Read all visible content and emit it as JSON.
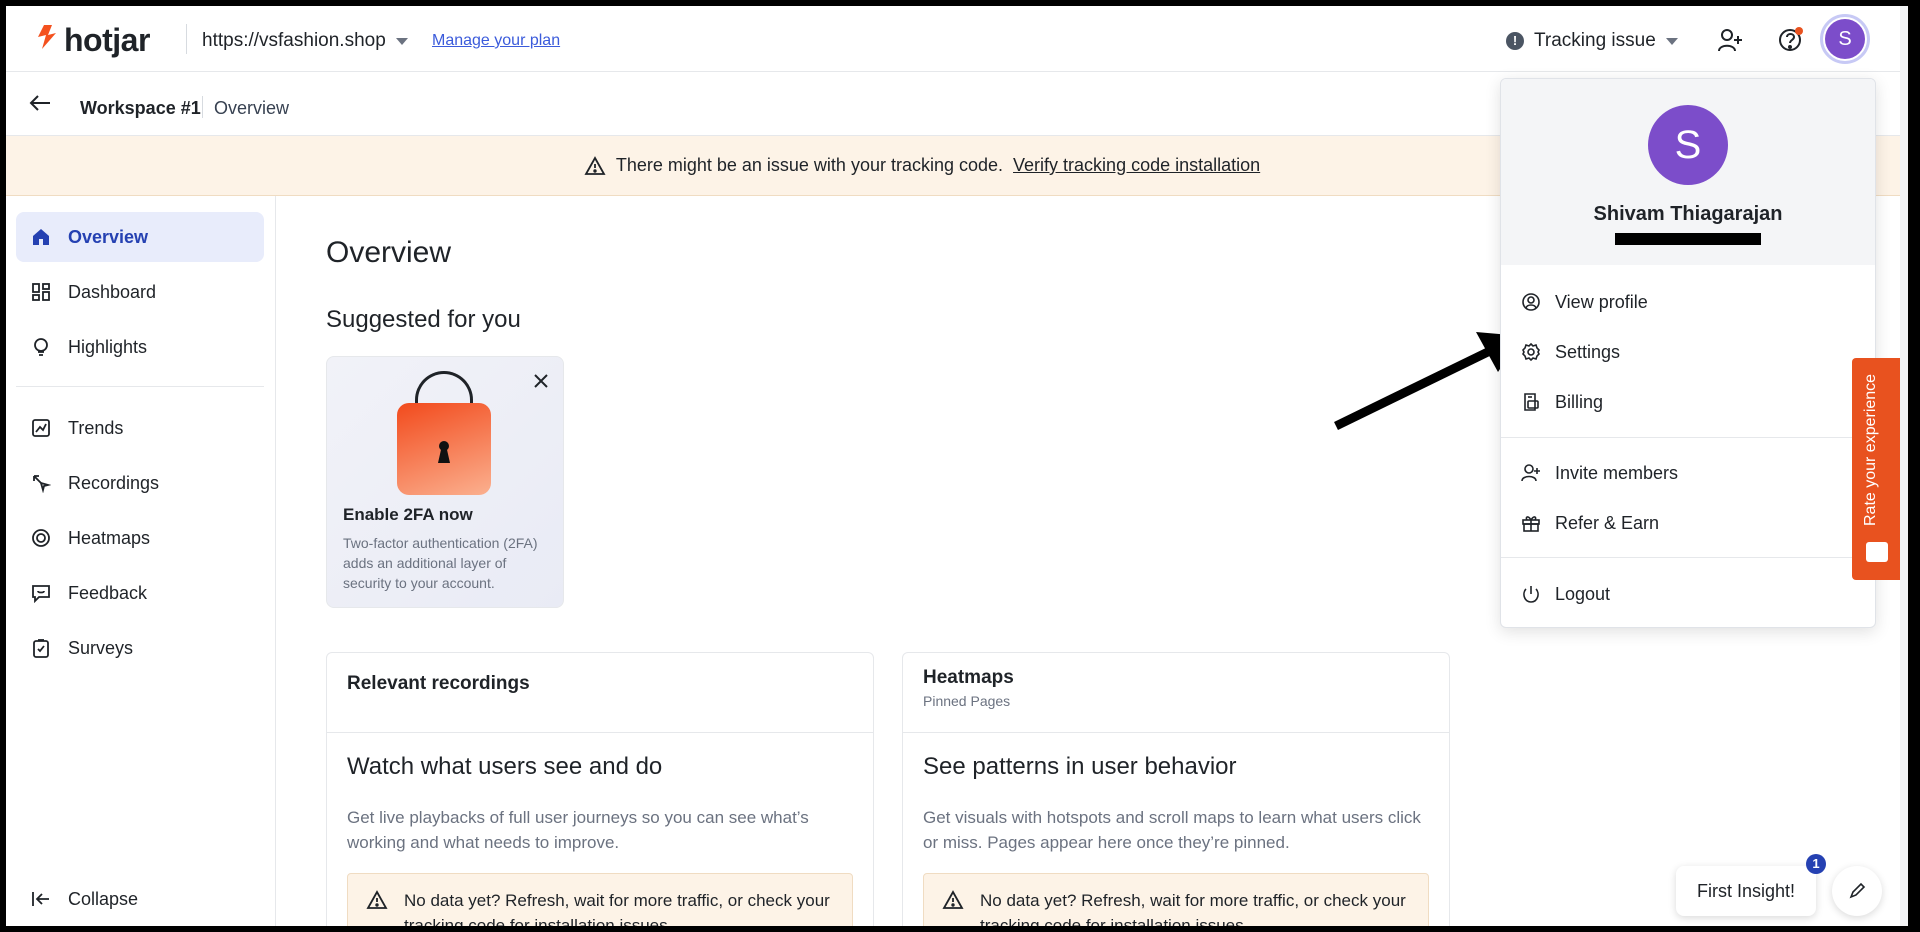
{
  "header": {
    "logo_text": "hotjar",
    "site_url": "https://vsfashion.shop",
    "manage_plan": "Manage your plan",
    "tracking_status": "Tracking issue",
    "avatar_initial": "S"
  },
  "breadcrumb": {
    "workspace": "Workspace #1",
    "page": "Overview"
  },
  "banner": {
    "message": "There might be an issue with your tracking code.",
    "link": "Verify tracking code installation"
  },
  "sidebar": {
    "items": [
      {
        "label": "Overview",
        "icon": "home-icon",
        "active": true
      },
      {
        "label": "Dashboard",
        "icon": "dashboard-icon"
      },
      {
        "label": "Highlights",
        "icon": "lightbulb-icon"
      },
      {
        "label": "Trends",
        "icon": "trends-icon"
      },
      {
        "label": "Recordings",
        "icon": "recordings-icon"
      },
      {
        "label": "Heatmaps",
        "icon": "heatmaps-icon"
      },
      {
        "label": "Feedback",
        "icon": "feedback-icon"
      },
      {
        "label": "Surveys",
        "icon": "surveys-icon"
      }
    ],
    "collapse": "Collapse"
  },
  "main": {
    "title": "Overview",
    "suggested_heading": "Suggested for you",
    "card_2fa": {
      "title": "Enable 2FA now",
      "description": "Two-factor authentication (2FA) adds an additional layer of security to your account."
    },
    "panels": [
      {
        "title": "Relevant recordings",
        "subtitle": "",
        "headline": "Watch what users see and do",
        "text": "Get live playbacks of full user journeys so you can see what’s working and what needs to improve.",
        "alert": "No data yet? Refresh, wait for more traffic, or check your tracking code for installation issues."
      },
      {
        "title": "Heatmaps",
        "subtitle": "Pinned Pages",
        "headline": "See patterns in user behavior",
        "text": "Get visuals with hotspots and scroll maps to learn what users click or miss. Pages appear here once they’re pinned.",
        "alert": "No data yet? Refresh, wait for more traffic, or check your tracking code for installation issues."
      }
    ]
  },
  "profile_menu": {
    "initial": "S",
    "name": "Shivam Thiagarajan",
    "items": [
      {
        "label": "View profile",
        "icon": "user-circle-icon"
      },
      {
        "label": "Settings",
        "icon": "gear-icon"
      },
      {
        "label": "Billing",
        "icon": "billing-icon"
      },
      {
        "label": "Invite members",
        "icon": "invite-user-icon"
      },
      {
        "label": "Refer & Earn",
        "icon": "gift-icon"
      },
      {
        "label": "Logout",
        "icon": "power-icon"
      }
    ]
  },
  "widgets": {
    "rate_experience": "Rate your experience",
    "first_insight": "First Insight!",
    "first_insight_badge": "1"
  },
  "colors": {
    "brand": "#f4511e",
    "accent": "#2541b2",
    "avatar": "#7c4dca",
    "warning_bg": "#fdf3e7"
  }
}
